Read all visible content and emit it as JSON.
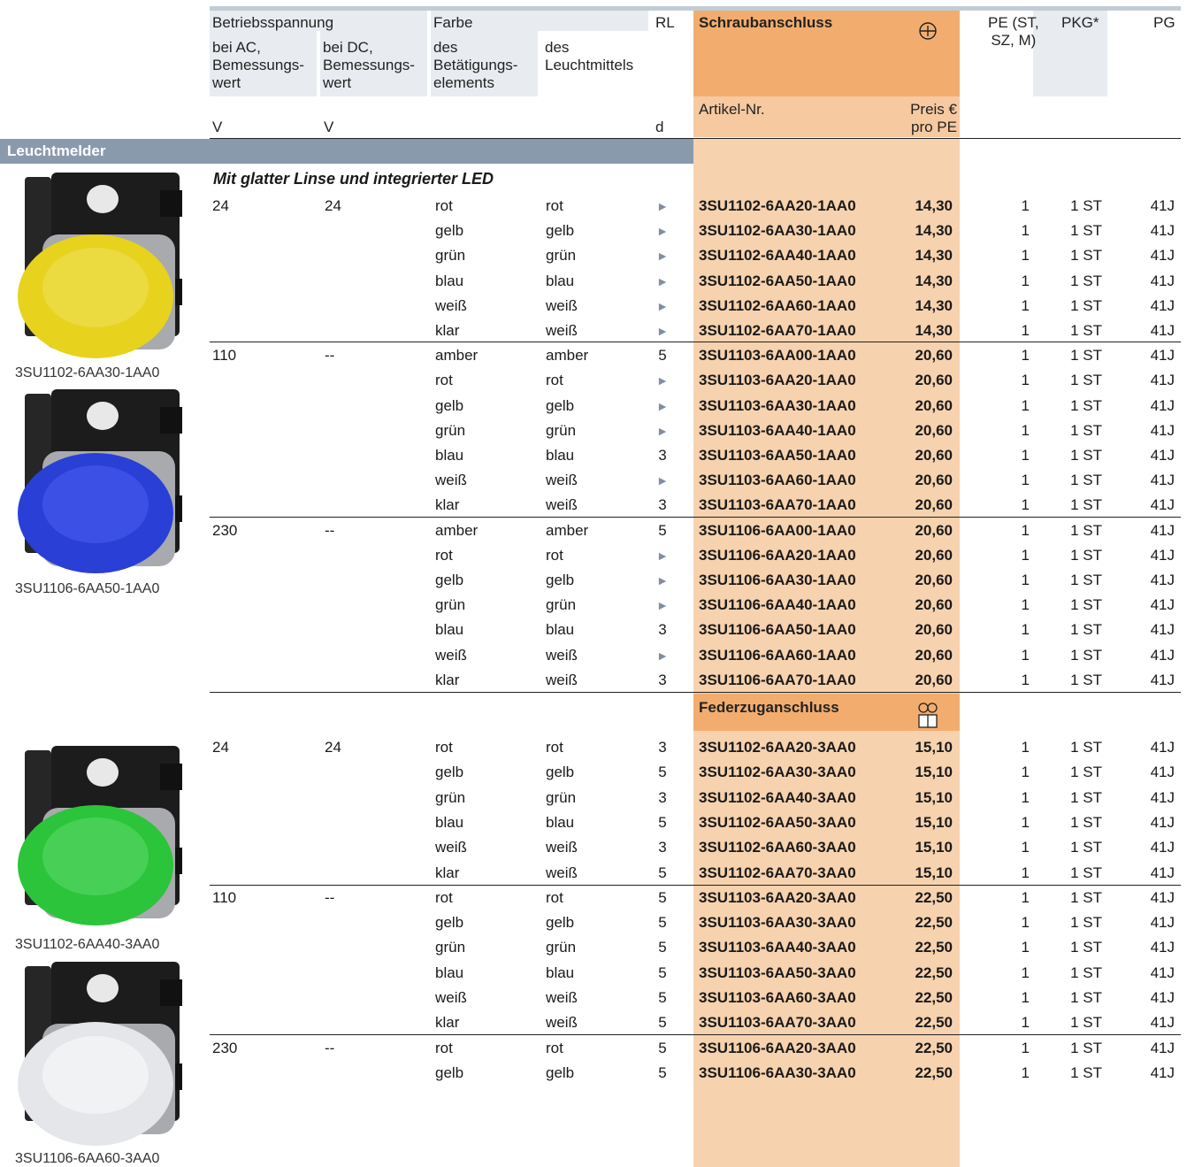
{
  "header": {
    "betriebsspannung": "Betriebsspannung",
    "ac": "bei AC,\nBemessungs-\nwert",
    "dc": "bei DC,\nBemessungs-\nwert",
    "farbe": "Farbe",
    "bet": "des\nBetätigungs-\nelements",
    "leucht": "des\nLeuchtmittels",
    "rl": "RL",
    "schraub": "Schraubanschluss",
    "pe": "PE (ST,\nSZ, M)",
    "pkg": "PKG*",
    "pg": "PG",
    "unit_v1": "V",
    "unit_v2": "V",
    "unit_d": "d",
    "artikel": "Artikel-Nr.",
    "preis": "Preis €\npro PE"
  },
  "section_title": "Leuchtmelder",
  "subheading": "Mit glatter Linse und integrierter LED",
  "feder_title": "Federzuganschluss",
  "captions": [
    "3SU1102-6AA30-1AA0",
    "3SU1106-6AA50-1AA0",
    "3SU1102-6AA40-3AA0",
    "3SU1106-6AA60-3AA0"
  ],
  "rl_arrow_symbol": "►",
  "rows": [
    {
      "ac": "24",
      "dc": "24",
      "c1": "rot",
      "c2": "rot",
      "rl": "►",
      "art": "3SU1102-6AA20-1AA0",
      "price": "14,30",
      "pe": "1",
      "pkg": "1 ST",
      "pg": "41J"
    },
    {
      "ac": "",
      "dc": "",
      "c1": "gelb",
      "c2": "gelb",
      "rl": "►",
      "art": "3SU1102-6AA30-1AA0",
      "price": "14,30",
      "pe": "1",
      "pkg": "1 ST",
      "pg": "41J"
    },
    {
      "ac": "",
      "dc": "",
      "c1": "grün",
      "c2": "grün",
      "rl": "►",
      "art": "3SU1102-6AA40-1AA0",
      "price": "14,30",
      "pe": "1",
      "pkg": "1 ST",
      "pg": "41J"
    },
    {
      "ac": "",
      "dc": "",
      "c1": "blau",
      "c2": "blau",
      "rl": "►",
      "art": "3SU1102-6AA50-1AA0",
      "price": "14,30",
      "pe": "1",
      "pkg": "1 ST",
      "pg": "41J"
    },
    {
      "ac": "",
      "dc": "",
      "c1": "weiß",
      "c2": "weiß",
      "rl": "►",
      "art": "3SU1102-6AA60-1AA0",
      "price": "14,30",
      "pe": "1",
      "pkg": "1 ST",
      "pg": "41J"
    },
    {
      "ac": "",
      "dc": "",
      "c1": "klar",
      "c2": "weiß",
      "rl": "►",
      "art": "3SU1102-6AA70-1AA0",
      "price": "14,30",
      "pe": "1",
      "pkg": "1 ST",
      "pg": "41J"
    },
    {
      "ac": "110",
      "dc": "--",
      "c1": "amber",
      "c2": "amber",
      "rl": "5",
      "art": "3SU1103-6AA00-1AA0",
      "price": "20,60",
      "pe": "1",
      "pkg": "1 ST",
      "pg": "41J"
    },
    {
      "ac": "",
      "dc": "",
      "c1": "rot",
      "c2": "rot",
      "rl": "►",
      "art": "3SU1103-6AA20-1AA0",
      "price": "20,60",
      "pe": "1",
      "pkg": "1 ST",
      "pg": "41J"
    },
    {
      "ac": "",
      "dc": "",
      "c1": "gelb",
      "c2": "gelb",
      "rl": "►",
      "art": "3SU1103-6AA30-1AA0",
      "price": "20,60",
      "pe": "1",
      "pkg": "1 ST",
      "pg": "41J"
    },
    {
      "ac": "",
      "dc": "",
      "c1": "grün",
      "c2": "grün",
      "rl": "►",
      "art": "3SU1103-6AA40-1AA0",
      "price": "20,60",
      "pe": "1",
      "pkg": "1 ST",
      "pg": "41J"
    },
    {
      "ac": "",
      "dc": "",
      "c1": "blau",
      "c2": "blau",
      "rl": "3",
      "art": "3SU1103-6AA50-1AA0",
      "price": "20,60",
      "pe": "1",
      "pkg": "1 ST",
      "pg": "41J"
    },
    {
      "ac": "",
      "dc": "",
      "c1": "weiß",
      "c2": "weiß",
      "rl": "►",
      "art": "3SU1103-6AA60-1AA0",
      "price": "20,60",
      "pe": "1",
      "pkg": "1 ST",
      "pg": "41J"
    },
    {
      "ac": "",
      "dc": "",
      "c1": "klar",
      "c2": "weiß",
      "rl": "3",
      "art": "3SU1103-6AA70-1AA0",
      "price": "20,60",
      "pe": "1",
      "pkg": "1 ST",
      "pg": "41J"
    },
    {
      "ac": "230",
      "dc": "--",
      "c1": "amber",
      "c2": "amber",
      "rl": "5",
      "art": "3SU1106-6AA00-1AA0",
      "price": "20,60",
      "pe": "1",
      "pkg": "1 ST",
      "pg": "41J"
    },
    {
      "ac": "",
      "dc": "",
      "c1": "rot",
      "c2": "rot",
      "rl": "►",
      "art": "3SU1106-6AA20-1AA0",
      "price": "20,60",
      "pe": "1",
      "pkg": "1 ST",
      "pg": "41J"
    },
    {
      "ac": "",
      "dc": "",
      "c1": "gelb",
      "c2": "gelb",
      "rl": "►",
      "art": "3SU1106-6AA30-1AA0",
      "price": "20,60",
      "pe": "1",
      "pkg": "1 ST",
      "pg": "41J"
    },
    {
      "ac": "",
      "dc": "",
      "c1": "grün",
      "c2": "grün",
      "rl": "►",
      "art": "3SU1106-6AA40-1AA0",
      "price": "20,60",
      "pe": "1",
      "pkg": "1 ST",
      "pg": "41J"
    },
    {
      "ac": "",
      "dc": "",
      "c1": "blau",
      "c2": "blau",
      "rl": "3",
      "art": "3SU1106-6AA50-1AA0",
      "price": "20,60",
      "pe": "1",
      "pkg": "1 ST",
      "pg": "41J"
    },
    {
      "ac": "",
      "dc": "",
      "c1": "weiß",
      "c2": "weiß",
      "rl": "►",
      "art": "3SU1106-6AA60-1AA0",
      "price": "20,60",
      "pe": "1",
      "pkg": "1 ST",
      "pg": "41J"
    },
    {
      "ac": "",
      "dc": "",
      "c1": "klar",
      "c2": "weiß",
      "rl": "3",
      "art": "3SU1106-6AA70-1AA0",
      "price": "20,60",
      "pe": "1",
      "pkg": "1 ST",
      "pg": "41J"
    },
    {
      "ac": "24",
      "dc": "24",
      "c1": "rot",
      "c2": "rot",
      "rl": "3",
      "art": "3SU1102-6AA20-3AA0",
      "price": "15,10",
      "pe": "1",
      "pkg": "1 ST",
      "pg": "41J"
    },
    {
      "ac": "",
      "dc": "",
      "c1": "gelb",
      "c2": "gelb",
      "rl": "5",
      "art": "3SU1102-6AA30-3AA0",
      "price": "15,10",
      "pe": "1",
      "pkg": "1 ST",
      "pg": "41J"
    },
    {
      "ac": "",
      "dc": "",
      "c1": "grün",
      "c2": "grün",
      "rl": "3",
      "art": "3SU1102-6AA40-3AA0",
      "price": "15,10",
      "pe": "1",
      "pkg": "1 ST",
      "pg": "41J"
    },
    {
      "ac": "",
      "dc": "",
      "c1": "blau",
      "c2": "blau",
      "rl": "5",
      "art": "3SU1102-6AA50-3AA0",
      "price": "15,10",
      "pe": "1",
      "pkg": "1 ST",
      "pg": "41J"
    },
    {
      "ac": "",
      "dc": "",
      "c1": "weiß",
      "c2": "weiß",
      "rl": "3",
      "art": "3SU1102-6AA60-3AA0",
      "price": "15,10",
      "pe": "1",
      "pkg": "1 ST",
      "pg": "41J"
    },
    {
      "ac": "",
      "dc": "",
      "c1": "klar",
      "c2": "weiß",
      "rl": "5",
      "art": "3SU1102-6AA70-3AA0",
      "price": "15,10",
      "pe": "1",
      "pkg": "1 ST",
      "pg": "41J"
    },
    {
      "ac": "110",
      "dc": "--",
      "c1": "rot",
      "c2": "rot",
      "rl": "5",
      "art": "3SU1103-6AA20-3AA0",
      "price": "22,50",
      "pe": "1",
      "pkg": "1 ST",
      "pg": "41J"
    },
    {
      "ac": "",
      "dc": "",
      "c1": "gelb",
      "c2": "gelb",
      "rl": "5",
      "art": "3SU1103-6AA30-3AA0",
      "price": "22,50",
      "pe": "1",
      "pkg": "1 ST",
      "pg": "41J"
    },
    {
      "ac": "",
      "dc": "",
      "c1": "grün",
      "c2": "grün",
      "rl": "5",
      "art": "3SU1103-6AA40-3AA0",
      "price": "22,50",
      "pe": "1",
      "pkg": "1 ST",
      "pg": "41J"
    },
    {
      "ac": "",
      "dc": "",
      "c1": "blau",
      "c2": "blau",
      "rl": "5",
      "art": "3SU1103-6AA50-3AA0",
      "price": "22,50",
      "pe": "1",
      "pkg": "1 ST",
      "pg": "41J"
    },
    {
      "ac": "",
      "dc": "",
      "c1": "weiß",
      "c2": "weiß",
      "rl": "5",
      "art": "3SU1103-6AA60-3AA0",
      "price": "22,50",
      "pe": "1",
      "pkg": "1 ST",
      "pg": "41J"
    },
    {
      "ac": "",
      "dc": "",
      "c1": "klar",
      "c2": "weiß",
      "rl": "5",
      "art": "3SU1103-6AA70-3AA0",
      "price": "22,50",
      "pe": "1",
      "pkg": "1 ST",
      "pg": "41J"
    },
    {
      "ac": "230",
      "dc": "--",
      "c1": "rot",
      "c2": "rot",
      "rl": "5",
      "art": "3SU1106-6AA20-3AA0",
      "price": "22,50",
      "pe": "1",
      "pkg": "1 ST",
      "pg": "41J"
    },
    {
      "ac": "",
      "dc": "",
      "c1": "gelb",
      "c2": "gelb",
      "rl": "5",
      "art": "3SU1106-6AA30-3AA0",
      "price": "22,50",
      "pe": "1",
      "pkg": "1 ST",
      "pg": "41J"
    }
  ],
  "lens_colors": [
    "#e7d21e",
    "#2a3fd6",
    "#2cc43a",
    "#e4e6ea"
  ],
  "icons": [
    "screw-terminal-icon",
    "spring-terminal-icon"
  ]
}
